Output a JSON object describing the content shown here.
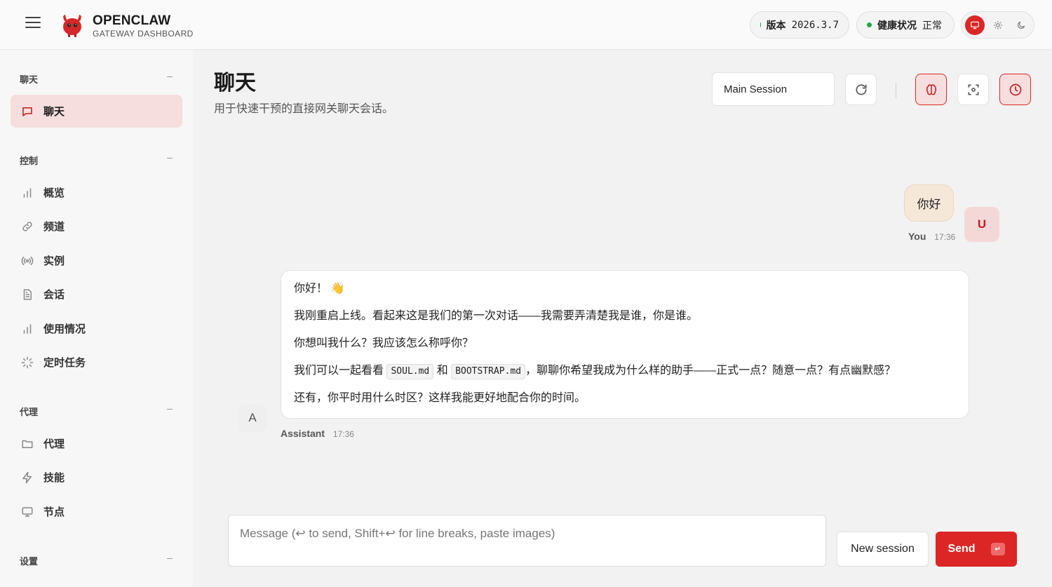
{
  "header": {
    "brand_title": "OPENCLAW",
    "brand_subtitle": "GATEWAY DASHBOARD",
    "version_label": "版本",
    "version_value": "2026.3.7",
    "health_label": "健康状况",
    "health_value": "正常",
    "status_color": "#22a745",
    "accent_color": "#dc2626"
  },
  "sidebar": {
    "sections": [
      {
        "title": "聊天",
        "items": [
          {
            "label": "聊天",
            "icon": "message-icon",
            "active": true
          }
        ]
      },
      {
        "title": "控制",
        "items": [
          {
            "label": "概览",
            "icon": "bar-chart-icon"
          },
          {
            "label": "频道",
            "icon": "link-icon"
          },
          {
            "label": "实例",
            "icon": "radio-icon"
          },
          {
            "label": "会话",
            "icon": "file-text-icon"
          },
          {
            "label": "使用情况",
            "icon": "bar-chart-icon"
          },
          {
            "label": "定时任务",
            "icon": "loader-icon"
          }
        ]
      },
      {
        "title": "代理",
        "items": [
          {
            "label": "代理",
            "icon": "folder-icon"
          },
          {
            "label": "技能",
            "icon": "zap-icon"
          },
          {
            "label": "节点",
            "icon": "monitor-icon"
          }
        ]
      },
      {
        "title": "设置",
        "items": []
      }
    ]
  },
  "main": {
    "title": "聊天",
    "subtitle": "用于快速干预的直接网关聊天会话。",
    "session_select": "Main Session"
  },
  "chat": {
    "user_message": "你好",
    "user_avatar": "U",
    "user_name": "You",
    "user_time": "17:36",
    "assistant_avatar": "A",
    "assistant_name": "Assistant",
    "assistant_time": "17:36",
    "assistant_lines": {
      "l1": "你好！ 👋",
      "l2": "我刚重启上线。看起来这是我们的第一次对话——我需要弄清楚我是谁，你是谁。",
      "l3": "你想叫我什么？我应该怎么称呼你？",
      "l4_pre": "我们可以一起看看",
      "l4_code1": "SOUL.md",
      "l4_mid": "和",
      "l4_code2": "BOOTSTRAP.md",
      "l4_post": "，聊聊你希望我成为什么样的助手——正式一点？随意一点？有点幽默感？",
      "l5": "还有，你平时用什么时区？这样我能更好地配合你的时间。"
    }
  },
  "composer": {
    "placeholder": "Message (↩ to send, Shift+↩ for line breaks, paste images)",
    "new_session_label": "New session",
    "send_label": "Send",
    "send_kbd": "↵"
  }
}
